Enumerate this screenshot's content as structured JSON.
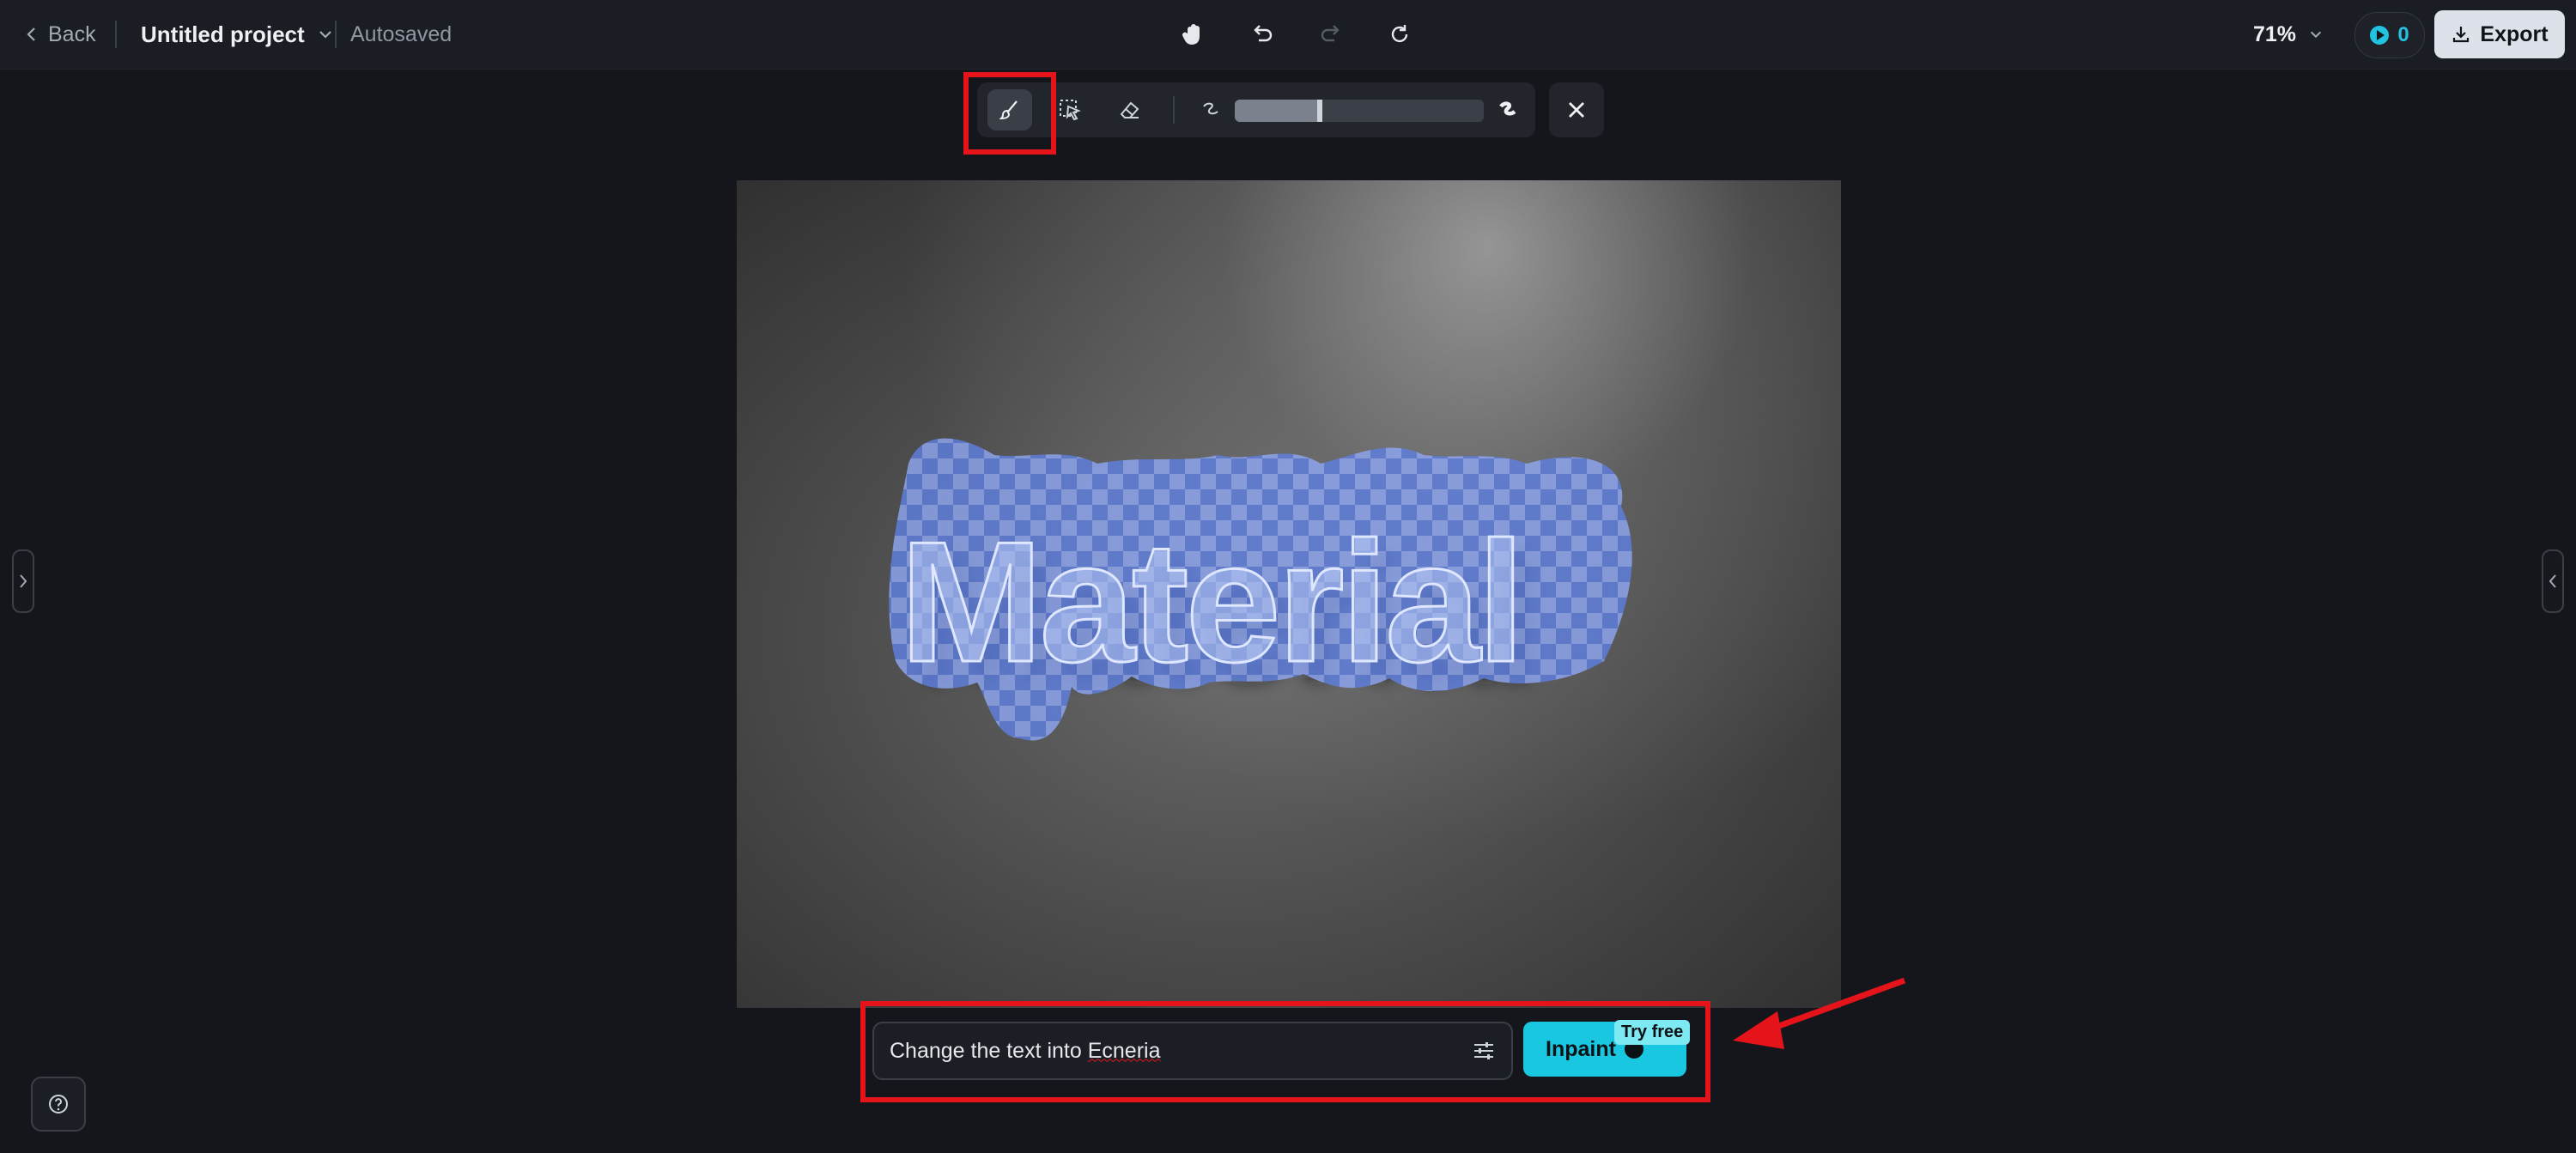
{
  "header": {
    "back_label": "Back",
    "project_name": "Untitled project",
    "autosave_status": "Autosaved",
    "zoom_level": "71%",
    "credits_count": "0",
    "export_label": "Export",
    "icons": [
      "hand-pan-icon",
      "undo-icon",
      "redo-icon",
      "refresh-icon"
    ]
  },
  "brush_toolbar": {
    "tools": [
      "brush-icon",
      "smart-select-icon",
      "eraser-icon"
    ],
    "brush_size_fraction": 0.34,
    "size_min_icon": "small-brush-icon",
    "size_max_icon": "large-brush-icon",
    "close_icon": "close-icon"
  },
  "canvas": {
    "image_text": "Material",
    "description_colors": {
      "mask": "#6a8cf5",
      "wall": "#555555"
    }
  },
  "prompt": {
    "text_prefix": "Change the text into ",
    "text_misspelled": "Ecneria",
    "inpaint_label": "Inpaint",
    "try_free_badge": "Try free"
  },
  "colors": {
    "accent": "#19c7e0",
    "highlight": "#e5141b",
    "background": "#14161b"
  }
}
